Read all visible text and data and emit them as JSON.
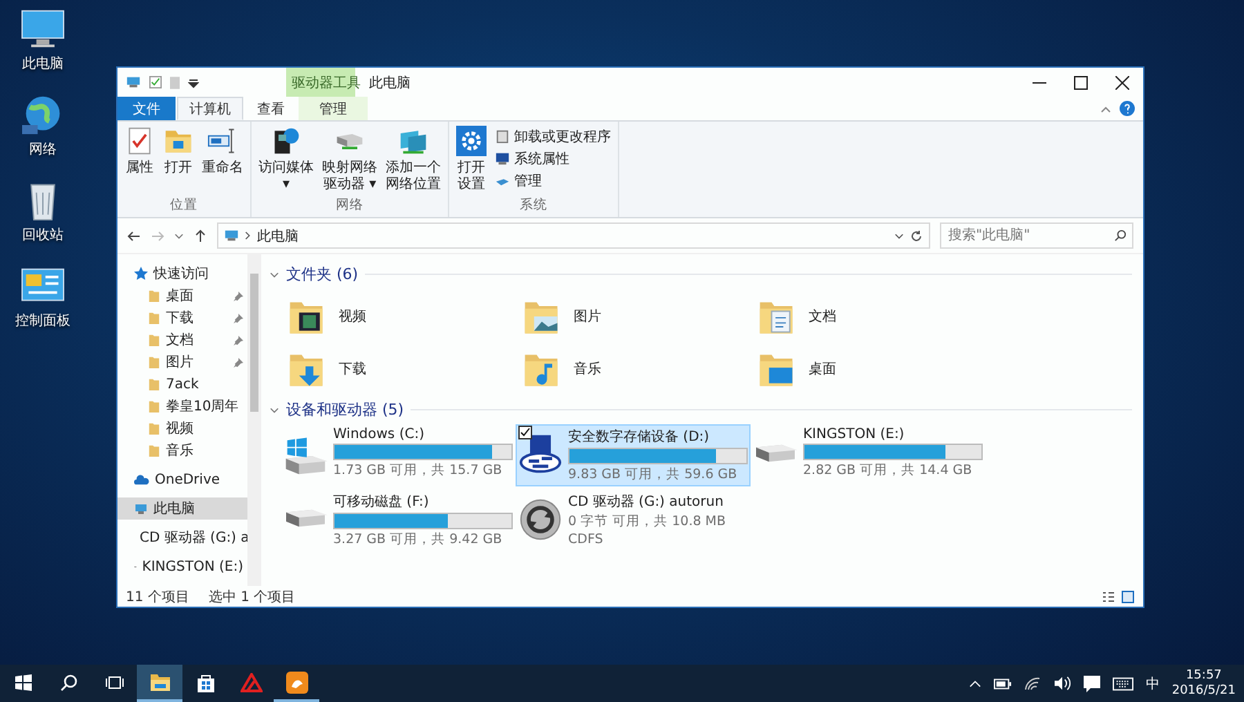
{
  "desktop_icons": [
    {
      "label": "此电脑",
      "kind": "pc"
    },
    {
      "label": "网络",
      "kind": "network"
    },
    {
      "label": "回收站",
      "kind": "recycle"
    },
    {
      "label": "控制面板",
      "kind": "control-panel"
    }
  ],
  "window": {
    "title": "此电脑",
    "context_group": "驱动器工具"
  },
  "tabs": [
    {
      "label": "文件",
      "kind": "file",
      "selected": false
    },
    {
      "label": "计算机",
      "kind": "normal",
      "selected": true
    },
    {
      "label": "查看",
      "kind": "normal",
      "selected": false
    },
    {
      "label": "管理",
      "kind": "context",
      "selected": false
    }
  ],
  "ribbon": {
    "groups": [
      {
        "label": "位置",
        "buttons": [
          {
            "lines": [
              "属性"
            ],
            "kind": "properties"
          },
          {
            "lines": [
              "打开"
            ],
            "kind": "open"
          },
          {
            "lines": [
              "重命名"
            ],
            "kind": "rename"
          }
        ]
      },
      {
        "label": "网络",
        "buttons": [
          {
            "lines": [
              "访问媒体",
              "▾"
            ],
            "kind": "media"
          },
          {
            "lines": [
              "映射网络",
              "驱动器 ▾"
            ],
            "kind": "map-drive"
          },
          {
            "lines": [
              "添加一个",
              "网络位置"
            ],
            "kind": "add-location"
          }
        ]
      },
      {
        "label": "系统",
        "buttons": [
          {
            "lines": [
              "打开",
              "设置"
            ],
            "kind": "settings"
          }
        ],
        "small_buttons": [
          {
            "label": "卸载或更改程序",
            "kind": "uninstall"
          },
          {
            "label": "系统属性",
            "kind": "system-props"
          },
          {
            "label": "管理",
            "kind": "manage"
          }
        ]
      }
    ]
  },
  "address": {
    "path": "此电脑",
    "search_placeholder": "搜索\"此电脑\""
  },
  "sidebar": {
    "items": [
      {
        "label": "快速访问",
        "kind": "quick",
        "selected": false,
        "children": [
          {
            "label": "桌面",
            "kind": "folder",
            "pinned": true,
            "selected": false
          },
          {
            "label": "下载",
            "kind": "folder",
            "pinned": true,
            "selected": false
          },
          {
            "label": "文档",
            "kind": "folder",
            "pinned": true,
            "selected": false
          },
          {
            "label": "图片",
            "kind": "folder",
            "pinned": true,
            "selected": false
          },
          {
            "label": "7ack",
            "kind": "folder",
            "pinned": false,
            "selected": false
          },
          {
            "label": "拳皇10周年",
            "kind": "folder",
            "pinned": false,
            "selected": false
          },
          {
            "label": "视频",
            "kind": "folder",
            "pinned": false,
            "selected": false
          },
          {
            "label": "音乐",
            "kind": "folder",
            "pinned": false,
            "selected": false
          }
        ]
      },
      {
        "label": "OneDrive",
        "kind": "cloud",
        "selected": false
      },
      {
        "label": "此电脑",
        "kind": "pc",
        "selected": true
      },
      {
        "label": "CD 驱动器 (G:) a",
        "kind": "cd",
        "selected": false
      },
      {
        "label": "KINGSTON (E:)",
        "kind": "usb",
        "selected": false
      }
    ]
  },
  "folders": {
    "heading": "文件夹 (6)",
    "items": [
      {
        "label": "视频",
        "kind": "videos"
      },
      {
        "label": "图片",
        "kind": "pictures"
      },
      {
        "label": "文档",
        "kind": "documents"
      },
      {
        "label": "下载",
        "kind": "downloads"
      },
      {
        "label": "音乐",
        "kind": "music"
      },
      {
        "label": "桌面",
        "kind": "desktop"
      }
    ]
  },
  "drives": {
    "heading": "设备和驱动器 (5)",
    "items": [
      {
        "name": "Windows (C:)",
        "kind": "system",
        "level": 0.89,
        "detail": "1.73 GB 可用，共 15.7 GB",
        "selected": false
      },
      {
        "name": "安全数字存储设备 (D:)",
        "kind": "sd",
        "level": 0.83,
        "detail": "9.83 GB 可用，共 59.6 GB",
        "selected": true
      },
      {
        "name": "KINGSTON (E:)",
        "kind": "usb",
        "level": 0.8,
        "detail": "2.82 GB 可用，共 14.4 GB",
        "selected": false
      },
      {
        "name": "可移动磁盘 (F:)",
        "kind": "usb",
        "level": 0.64,
        "detail": "3.27 GB 可用，共 9.42 GB",
        "selected": false
      },
      {
        "name": "CD 驱动器 (G:) autorun",
        "kind": "cd",
        "detail": "0 字节 可用，共 10.8 MB",
        "filesystem": "CDFS",
        "selected": false
      }
    ]
  },
  "status_bar": {
    "item_count": "11 个项目",
    "selection": "选中 1 个项目"
  },
  "taskbar": {
    "items": [
      {
        "kind": "start",
        "selected": false,
        "running": false
      },
      {
        "kind": "search",
        "selected": false,
        "running": false
      },
      {
        "kind": "task-view",
        "selected": false,
        "running": false
      },
      {
        "kind": "explorer",
        "selected": true,
        "running": true
      },
      {
        "kind": "store",
        "selected": false,
        "running": false
      },
      {
        "kind": "red-app",
        "selected": false,
        "running": false
      },
      {
        "kind": "orange-app",
        "selected": false,
        "running": true
      }
    ],
    "ime": "中",
    "time": "15:57",
    "date": "2016/5/21"
  }
}
